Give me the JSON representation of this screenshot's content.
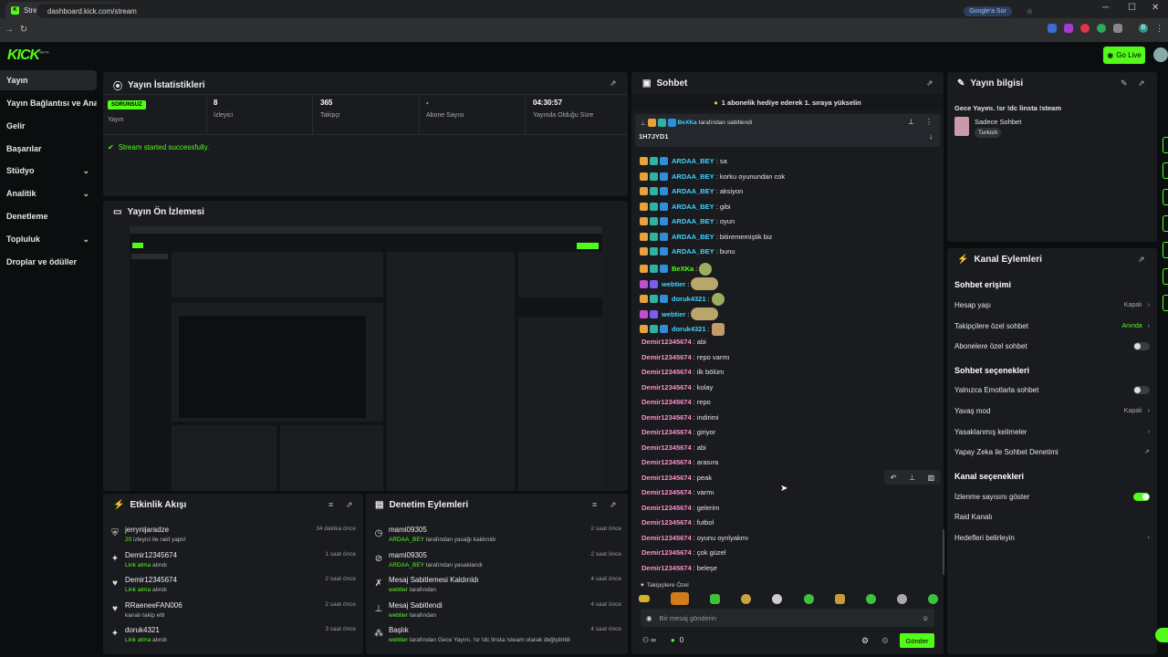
{
  "browser": {
    "tab_title": "Stream - Kick Dashboard",
    "url": "dashboard.kick.com/stream",
    "google_label": "Google'a Sor",
    "profile_initial": "B"
  },
  "brand": {
    "logo": "KICK",
    "logo_sup": "BETA",
    "accent": "#53fc18"
  },
  "header": {
    "go_live": "Go Live"
  },
  "sidebar": {
    "items": [
      {
        "label": "Yayın",
        "active": true
      },
      {
        "label": "Yayın Bağlantısı ve Anahtarı"
      },
      {
        "label": "Gelir"
      },
      {
        "label": "Başarılar"
      },
      {
        "label": "Stüdyo",
        "chevron": "⌄"
      },
      {
        "label": "Analitik",
        "chevron": "⌄"
      },
      {
        "label": "Denetleme"
      },
      {
        "label": "Topluluk",
        "chevron": "⌄"
      },
      {
        "label": "Droplar ve ödüller"
      }
    ]
  },
  "stats": {
    "title": "Yayın İstatistikleri",
    "status_badge": "SORUNSUZ",
    "status_label": "Yayın",
    "viewers": "8",
    "viewers_label": "İzleyici",
    "followers": "365",
    "followers_label": "Takipçi",
    "subs": "-",
    "subs_label": "Abone Sayısı",
    "uptime": "04:30:57",
    "uptime_label": "Yayında Olduğu Süre",
    "success": "Stream started successfully."
  },
  "preview": {
    "title": "Yayın Ön İzlemesi"
  },
  "activity": {
    "title": "Etkinlik Akışı",
    "items": [
      {
        "icon": "raid-icon",
        "glyph": "⛨",
        "name": "jerrynijaradze",
        "sub_hl": "20",
        "sub": " izleyici ile raid yaptı!",
        "time": "34 dakika önce"
      },
      {
        "icon": "gift-icon",
        "glyph": "✦",
        "name": "Demir12345674",
        "sub_hl": "Link atma",
        "sub": " alındı",
        "time": "1 saat önce"
      },
      {
        "icon": "heart-icon",
        "glyph": "♥",
        "name": "Demir12345674",
        "sub_hl": "Link atma",
        "sub": " alındı",
        "time": "2 saat önce"
      },
      {
        "icon": "heart-icon",
        "glyph": "♥",
        "name": "RRaeneeFAN006",
        "sub_hl": "",
        "sub": "kanalı takip etti",
        "time": "2 saat önce"
      },
      {
        "icon": "gift-icon",
        "glyph": "✦",
        "name": "doruk4321",
        "sub_hl": "Link atma",
        "sub": " alındı",
        "time": "3 saat önce"
      }
    ]
  },
  "moderation": {
    "title": "Denetim Eylemleri",
    "items": [
      {
        "icon": "unban-icon",
        "glyph": "◷",
        "name": "mami09305",
        "sub_hl": "ARDAA_BEY",
        "sub": " tarafından yasağı kaldırıldı",
        "time": "2 saat önce"
      },
      {
        "icon": "ban-icon",
        "glyph": "⊘",
        "name": "mami09305",
        "sub_hl": "ARDAA_BEY",
        "sub": " tarafından yasaklandı",
        "time": "2 saat önce"
      },
      {
        "icon": "unpin-icon",
        "glyph": "✗",
        "name": "Mesaj Sabitlemesi Kaldırıldı",
        "sub_hl": "webtier",
        "sub": " tarafından",
        "time": "4 saat önce"
      },
      {
        "icon": "pin-icon",
        "glyph": "⊥",
        "name": "Mesaj Sabitlendi",
        "sub_hl": "webtier",
        "sub": " tarafından",
        "time": "4 saat önce"
      },
      {
        "icon": "title-icon",
        "glyph": "⁂",
        "name": "Başlık",
        "sub_hl": "webtier",
        "sub": " tarafından Gece Yayını. !sr !dc linsta !steam olarak değiştirildi",
        "time": "4 saat önce"
      }
    ]
  },
  "chat": {
    "title": "Sohbet",
    "gift_banner": "1 abonelik hediye ederek 1. sıraya yükselin",
    "pinned_by": "BeXKa",
    "pinned_suffix": " tarafından sabitlendi",
    "pinned_text": "1H7JYD1",
    "messages": [
      {
        "user": "ARDAA_BEY",
        "cls": "u1",
        "text": ": sa",
        "badges": 3
      },
      {
        "user": "ARDAA_BEY",
        "cls": "u1",
        "text": ": korku oyunundan cok",
        "badges": 3
      },
      {
        "user": "ARDAA_BEY",
        "cls": "u1",
        "text": ": aksiyon",
        "badges": 3
      },
      {
        "user": "ARDAA_BEY",
        "cls": "u1",
        "text": ": gibi",
        "badges": 3
      },
      {
        "user": "ARDAA_BEY",
        "cls": "u1",
        "text": ": oyun",
        "badges": 3
      },
      {
        "user": "ARDAA_BEY",
        "cls": "u1",
        "text": ": bitirememiştik biz",
        "badges": 3
      },
      {
        "user": "ARDAA_BEY",
        "cls": "u1",
        "text": ": bunu",
        "badges": 3
      },
      {
        "user": "BeXKa",
        "cls": "u3",
        "text": ":",
        "badges": 3,
        "emote": "sm"
      },
      {
        "user": "webtier",
        "cls": "u1",
        "text": ":",
        "badges": 2,
        "emote": "wide"
      },
      {
        "user": "doruk4321",
        "cls": "u1",
        "text": ":",
        "badges": 3,
        "emote": "sm"
      },
      {
        "user": "webtier",
        "cls": "u1",
        "text": ":",
        "badges": 2,
        "emote": "wide"
      },
      {
        "user": "doruk4321",
        "cls": "u1",
        "text": ":",
        "badges": 3,
        "emote": "sq"
      },
      {
        "user": "Demir12345674",
        "cls": "u2",
        "text": ": abi",
        "badges": 0
      },
      {
        "user": "Demir12345674",
        "cls": "u2",
        "text": ": repo varmı",
        "badges": 0
      },
      {
        "user": "Demir12345674",
        "cls": "u2",
        "text": ": ilk bölüm",
        "badges": 0
      },
      {
        "user": "Demir12345674",
        "cls": "u2",
        "text": ": kolay",
        "badges": 0
      },
      {
        "user": "Demir12345674",
        "cls": "u2",
        "text": ": repo",
        "badges": 0
      },
      {
        "user": "Demir12345674",
        "cls": "u2",
        "text": ": indirimi",
        "badges": 0
      },
      {
        "user": "Demir12345674",
        "cls": "u2",
        "text": ": giriyor",
        "badges": 0
      },
      {
        "user": "Demir12345674",
        "cls": "u2",
        "text": ": abi",
        "badges": 0
      },
      {
        "user": "Demir12345674",
        "cls": "u2",
        "text": ": arasıra",
        "badges": 0
      },
      {
        "user": "Demir12345674",
        "cls": "u2",
        "text": ": peak",
        "badges": 0
      },
      {
        "user": "Demir12345674",
        "cls": "u2",
        "text": ": varmı",
        "badges": 0
      },
      {
        "user": "Demir12345674",
        "cls": "u2",
        "text": ": gelerim",
        "badges": 0
      },
      {
        "user": "Demir12345674",
        "cls": "u2",
        "text": ": futbol",
        "badges": 0
      },
      {
        "user": "Demir12345674",
        "cls": "u2",
        "text": ": oyunu oynlyakmı",
        "badges": 0
      },
      {
        "user": "Demir12345674",
        "cls": "u2",
        "text": ": çok güzel",
        "badges": 0
      },
      {
        "user": "Demir12345674",
        "cls": "u2",
        "text": ": beleşe",
        "badges": 0
      }
    ],
    "followers_only": "Takipçilere Özel",
    "input_placeholder": "Bir mesaj gönderin",
    "count_infinity": "∞",
    "count_zero": "0",
    "send": "Gönder"
  },
  "stream_info": {
    "title": "Yayın bilgisi",
    "stream_title": "Gece Yayını. !sr !dc linsta !steam",
    "category": "Sadece Sohbet",
    "tag": "Turkish"
  },
  "channel_actions": {
    "title": "Kanal Eylemleri",
    "chat_access": "Sohbet erişimi",
    "account_age": "Hesap yaşı",
    "account_age_val": "Kapalı",
    "followers_chat": "Takipçilere özel sohbet",
    "followers_chat_val": "Anında",
    "subs_chat": "Abonelere özel sohbet",
    "chat_options": "Sohbet seçenekleri",
    "emote_only": "Yalnızca Emotlarla sohbet",
    "slow_mode": "Yavaş mod",
    "slow_mode_val": "Kapalı",
    "banned_words": "Yasaklanmış kelimeler",
    "ai_mod": "Yapay Zeka ile Sohbet Denetimi",
    "channel_options": "Kanal seçenekleri",
    "show_viewers": "İzlenme sayısını göster",
    "raid_channel": "Raid Kanalı",
    "set_goals": "Hedefleri belirleyin"
  }
}
